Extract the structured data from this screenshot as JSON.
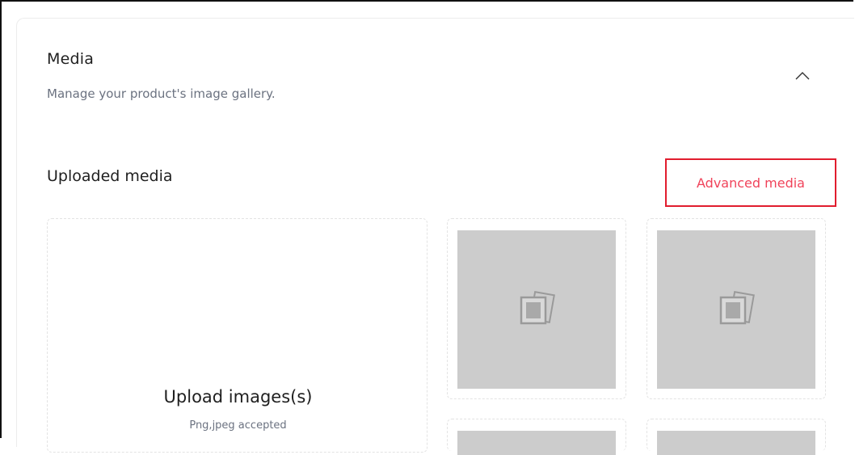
{
  "media": {
    "title": "Media",
    "subtitle": "Manage your product's image gallery.",
    "collapse_icon": "chevron-up-icon"
  },
  "uploaded": {
    "title": "Uploaded media",
    "advanced_label": "Advanced media",
    "highlight_color": "#e11d2e",
    "link_color": "#f0435a"
  },
  "upload": {
    "title": "Upload images(s)",
    "subtitle": "Png,jpeg accepted"
  },
  "thumbnails": [
    {
      "icon": "image-gallery-icon"
    },
    {
      "icon": "image-gallery-icon"
    },
    {
      "icon": "image-gallery-icon"
    },
    {
      "icon": "image-gallery-icon"
    }
  ]
}
